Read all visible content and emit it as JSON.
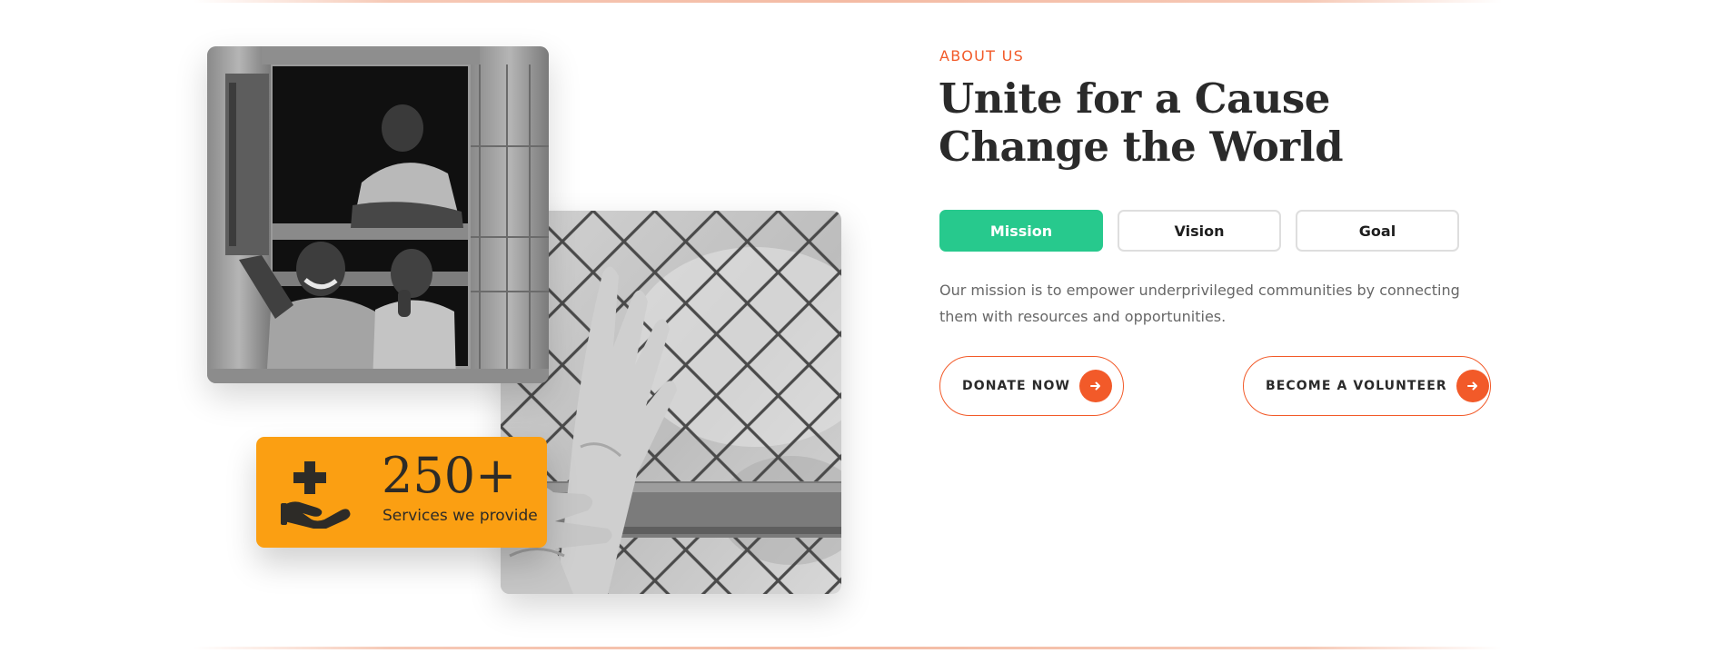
{
  "about": {
    "eyebrow": "ABOUT US",
    "heading_line1": "Unite for a Cause",
    "heading_line2": "Change the World"
  },
  "tabs": [
    {
      "label": "Mission",
      "active": true
    },
    {
      "label": "Vision",
      "active": false
    },
    {
      "label": "Goal",
      "active": false
    }
  ],
  "mission_text": "Our mission is to empower underprivileged communities by connecting them with resources and opportunities.",
  "buttons": {
    "donate": "DONATE NOW",
    "volunteer": "BECOME A VOLUNTEER"
  },
  "stat": {
    "number": "250+",
    "label": "Services we provide",
    "icon": "hand-holding-medical-icon"
  },
  "images": {
    "photo1": "children-at-window-photo",
    "photo2": "hands-on-fence-photo"
  },
  "colors": {
    "accent": "#f25a29",
    "tab_active": "#27c98d",
    "stat_card": "#fb9f12",
    "heading": "#2a2a2a",
    "body_text": "#676767"
  }
}
